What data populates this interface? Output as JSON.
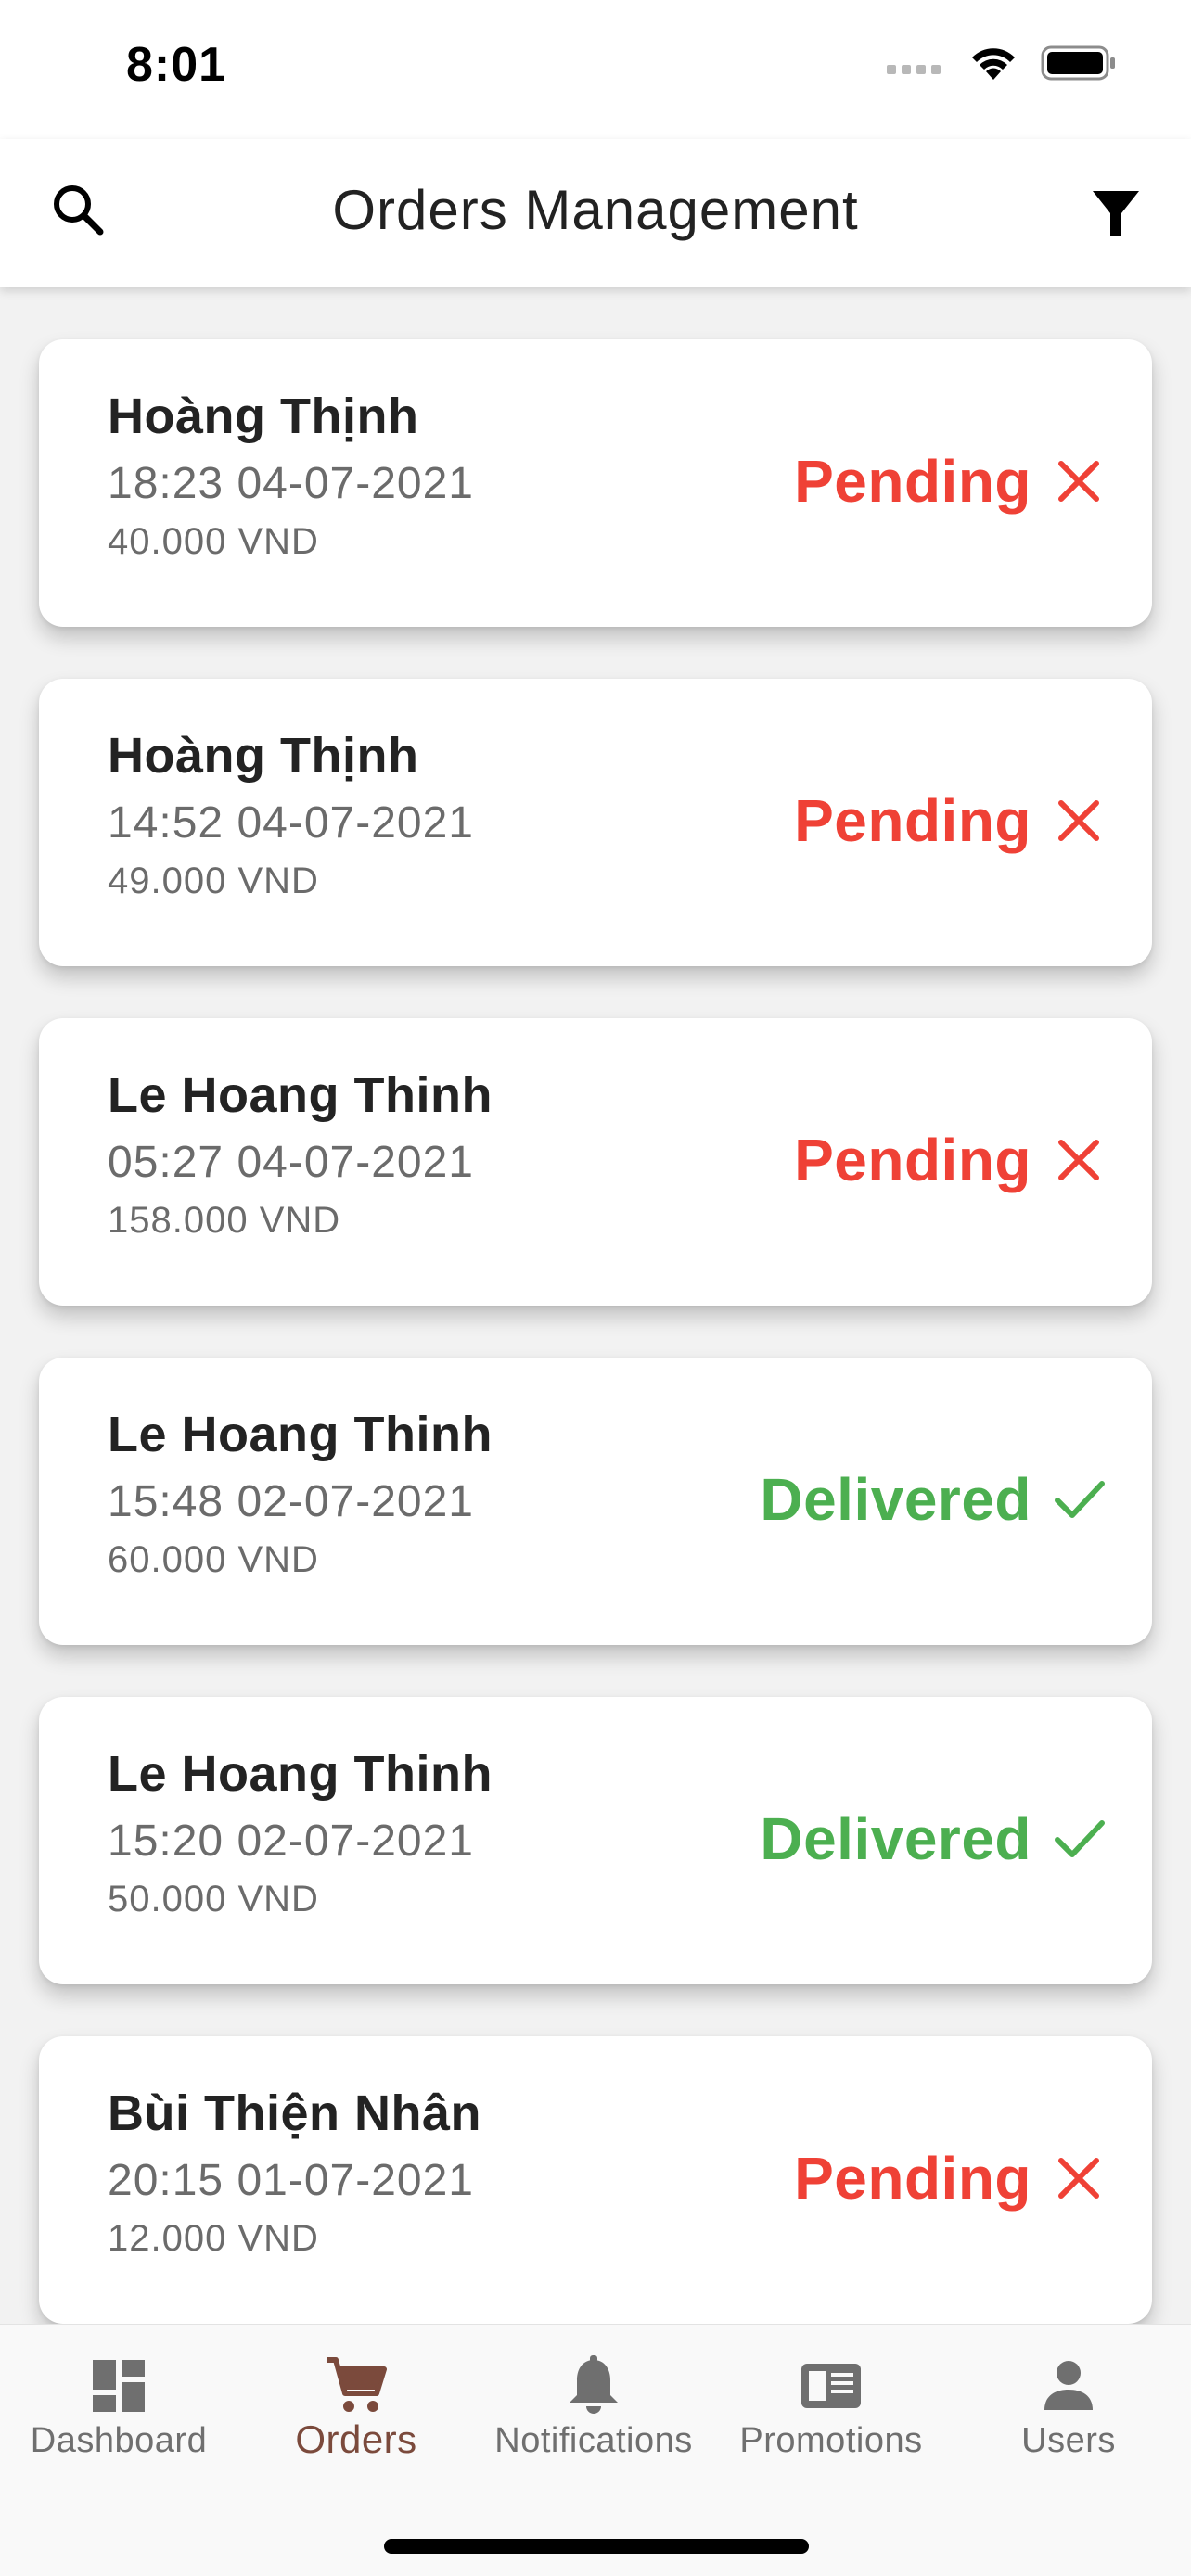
{
  "status_bar": {
    "time": "8:01"
  },
  "app_bar": {
    "title": "Orders Management"
  },
  "colors": {
    "pending": "#ef4136",
    "delivered": "#4caf50",
    "nav_active": "#7b4a3c",
    "nav_inactive": "#6f6f6f"
  },
  "orders": [
    {
      "name": "Hoàng Thịnh",
      "time": "18:23 04-07-2021",
      "amount": "40.000 VND",
      "status": "Pending",
      "status_icon": "close-icon"
    },
    {
      "name": "Hoàng Thịnh",
      "time": "14:52 04-07-2021",
      "amount": "49.000 VND",
      "status": "Pending",
      "status_icon": "close-icon"
    },
    {
      "name": "Le Hoang Thinh",
      "time": "05:27 04-07-2021",
      "amount": "158.000 VND",
      "status": "Pending",
      "status_icon": "close-icon"
    },
    {
      "name": "Le Hoang Thinh",
      "time": "15:48 02-07-2021",
      "amount": "60.000 VND",
      "status": "Delivered",
      "status_icon": "check-icon"
    },
    {
      "name": "Le Hoang Thinh",
      "time": "15:20 02-07-2021",
      "amount": "50.000 VND",
      "status": "Delivered",
      "status_icon": "check-icon"
    },
    {
      "name": "Bùi Thiện Nhân",
      "time": "20:15 01-07-2021",
      "amount": "12.000 VND",
      "status": "Pending",
      "status_icon": "close-icon"
    }
  ],
  "bottom_nav": {
    "items": [
      {
        "label": "Dashboard",
        "icon": "dashboard-icon",
        "active": false
      },
      {
        "label": "Orders",
        "icon": "cart-icon",
        "active": true
      },
      {
        "label": "Notifications",
        "icon": "bell-icon",
        "active": false
      },
      {
        "label": "Promotions",
        "icon": "newspaper-icon",
        "active": false
      },
      {
        "label": "Users",
        "icon": "person-icon",
        "active": false
      }
    ]
  }
}
